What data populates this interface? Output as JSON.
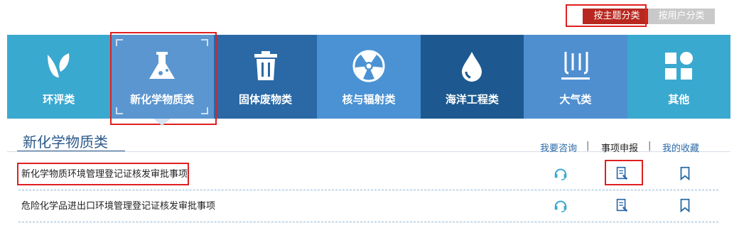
{
  "top": {
    "theme_button": "按主题分类",
    "user_button": "按用户分类"
  },
  "categories": [
    {
      "label": "环评类",
      "icon": "leaf-icon"
    },
    {
      "label": "新化学物质类",
      "icon": "flask-icon"
    },
    {
      "label": "固体废物类",
      "icon": "trash-icon"
    },
    {
      "label": "核与辐射类",
      "icon": "radiation-icon"
    },
    {
      "label": "海洋工程类",
      "icon": "drop-icon"
    },
    {
      "label": "大气类",
      "icon": "smoke-icon"
    },
    {
      "label": "其他",
      "icon": "grid-icon"
    }
  ],
  "colors": {
    "cat_bg": [
      "#3aaad0",
      "#5b96d0",
      "#2a6aa7",
      "#4a93d4",
      "#1d5a91",
      "#4f8fd0",
      "#3aaad0"
    ],
    "accent": "#2b6aa8"
  },
  "panel": {
    "title": "新化学物质类",
    "actions": {
      "consult": "我要咨询",
      "report": "事项申报",
      "favorite": "我的收藏",
      "sep": "|"
    }
  },
  "items": [
    {
      "name": "新化学物质环境管理登记证核发审批事项"
    },
    {
      "name": "危险化学品进出口环境管理登记证核发审批事项"
    }
  ]
}
